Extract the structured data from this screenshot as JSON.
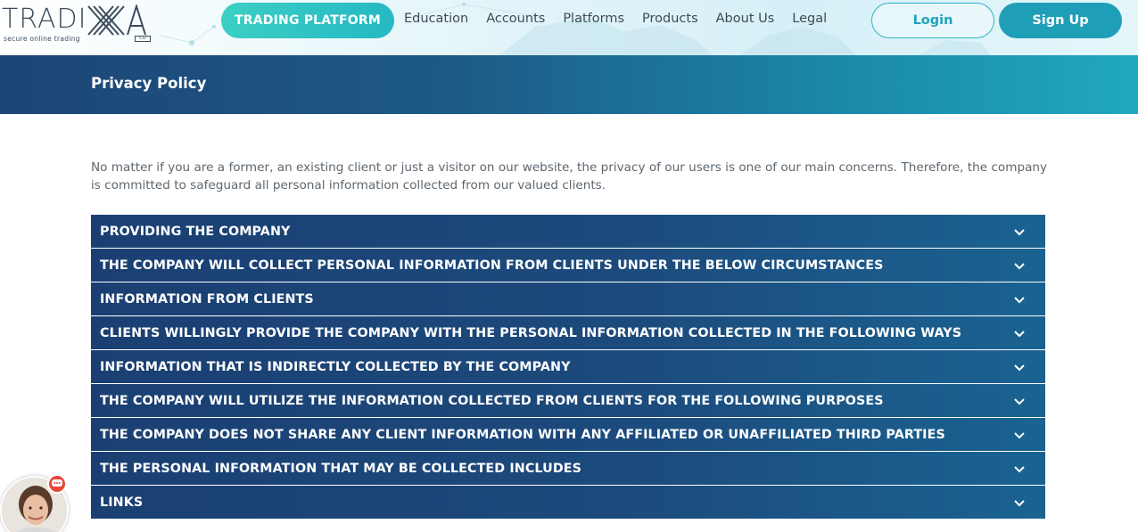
{
  "brand": {
    "name": "TRADIXA",
    "word": "TRADI",
    "tagline": "secure online trading",
    "suffix": "CO"
  },
  "header": {
    "trading_platform": "TRADING PLATFORM",
    "nav": [
      "Education",
      "Accounts",
      "Platforms",
      "Products",
      "About Us",
      "Legal"
    ],
    "login": "Login",
    "signup": "Sign Up"
  },
  "banner": {
    "title": "Privacy Policy"
  },
  "intro": "No matter if you are a former, an existing client or just a visitor on our website, the privacy of our users is one of our main concerns. Therefore, the company is committed to safeguard all personal information collected from our valued clients.",
  "accordion": [
    "PROVIDING THE COMPANY",
    "THE COMPANY WILL COLLECT PERSONAL INFORMATION FROM CLIENTS UNDER THE BELOW CIRCUMSTANCES",
    "INFORMATION FROM CLIENTS",
    "CLIENTS WILLINGLY PROVIDE THE COMPANY WITH THE PERSONAL INFORMATION COLLECTED IN THE FOLLOWING WAYS",
    "INFORMATION THAT IS INDIRECTLY COLLECTED BY THE COMPANY",
    "THE COMPANY WILL UTILIZE THE INFORMATION COLLECTED FROM CLIENTS FOR THE FOLLOWING PURPOSES",
    "THE COMPANY DOES NOT SHARE ANY CLIENT INFORMATION WITH ANY AFFILIATED OR UNAFFILIATED THIRD PARTIES",
    "THE PERSONAL INFORMATION THAT MAY BE COLLECTED INCLUDES",
    "LINKS"
  ],
  "icons": {
    "accordion_toggle": "chevron-down-icon",
    "chat_badge": "chat-bubble-icon",
    "chat_avatar": "support-agent-avatar"
  },
  "colors": {
    "teal": "#25b8c4",
    "navy": "#1b3f72",
    "signup": "#1f9fb7",
    "badge": "#e8473a"
  }
}
